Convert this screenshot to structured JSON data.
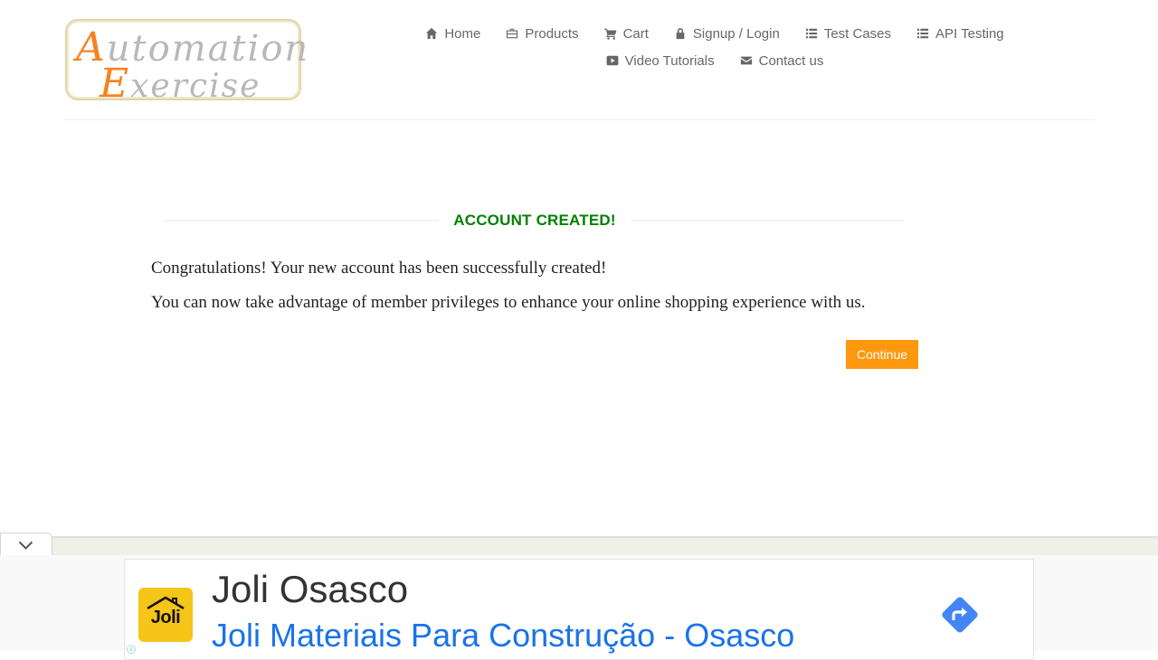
{
  "logo": {
    "line1_first": "A",
    "line1_rest": "utomation",
    "line2_first": "E",
    "line2_rest": "xercise"
  },
  "nav": {
    "items": [
      {
        "label": "Home",
        "icon": "home-icon"
      },
      {
        "label": "Products",
        "icon": "briefcase-icon"
      },
      {
        "label": "Cart",
        "icon": "cart-icon"
      },
      {
        "label": "Signup / Login",
        "icon": "lock-icon"
      },
      {
        "label": "Test Cases",
        "icon": "list-icon"
      },
      {
        "label": "API Testing",
        "icon": "list-icon"
      },
      {
        "label": "Video Tutorials",
        "icon": "youtube-icon"
      },
      {
        "label": "Contact us",
        "icon": "envelope-icon"
      }
    ]
  },
  "main": {
    "title": "ACCOUNT CREATED!",
    "message_1": "Congratulations! Your new account has been successfully created!",
    "message_2": "You can now take advantage of member privileges to enhance your online shopping experience with us.",
    "continue_label": "Continue"
  },
  "ad": {
    "logo_text": "Joli",
    "name": "Joli Osasco",
    "subtitle": "Joli Materiais Para Construção - Osasco",
    "info_icon": "info-icon",
    "collapse_icon": "chevron-down-icon",
    "directions_icon": "directions-icon"
  },
  "colors": {
    "accent_orange": "#fe980f",
    "success_green": "#008000",
    "nav_text": "#696763",
    "ad_link_blue": "#1a73e8"
  }
}
